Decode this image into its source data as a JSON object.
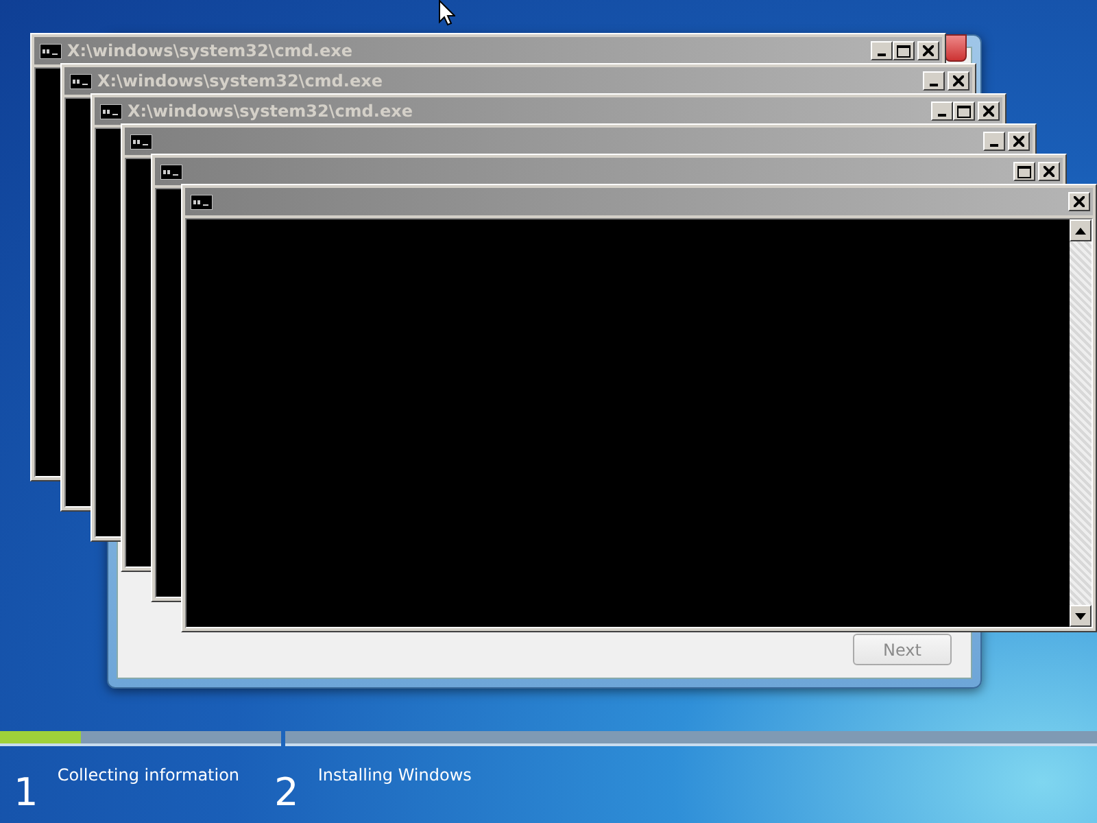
{
  "setup_dialog": {
    "next_button": {
      "label": "Next",
      "disabled": true
    }
  },
  "console_windows": [
    {
      "title": "X:\\windows\\system32\\cmd.exe",
      "buttons": [
        {
          "kind": "minimize"
        },
        {
          "kind": "maximize"
        },
        {
          "kind": "close"
        }
      ]
    },
    {
      "title": "X:\\windows\\system32\\cmd.exe",
      "buttons": [
        {
          "kind": "minimize"
        },
        {
          "kind": "close"
        }
      ]
    },
    {
      "title": "X:\\windows\\system32\\cmd.exe",
      "buttons": [
        {
          "kind": "minimize"
        },
        {
          "kind": "maximize"
        },
        {
          "kind": "close"
        }
      ]
    },
    {
      "buttons": [
        {
          "kind": "minimize"
        },
        {
          "kind": "close"
        }
      ]
    },
    {
      "buttons": [
        {
          "kind": "maximize"
        },
        {
          "kind": "close"
        }
      ]
    },
    {
      "buttons": [
        {
          "kind": "close"
        }
      ]
    }
  ],
  "progress": {
    "steps": [
      {
        "number": "1",
        "label": "Collecting information",
        "level": 0.29
      },
      {
        "number": "2",
        "label": "Installing Windows"
      }
    ]
  }
}
